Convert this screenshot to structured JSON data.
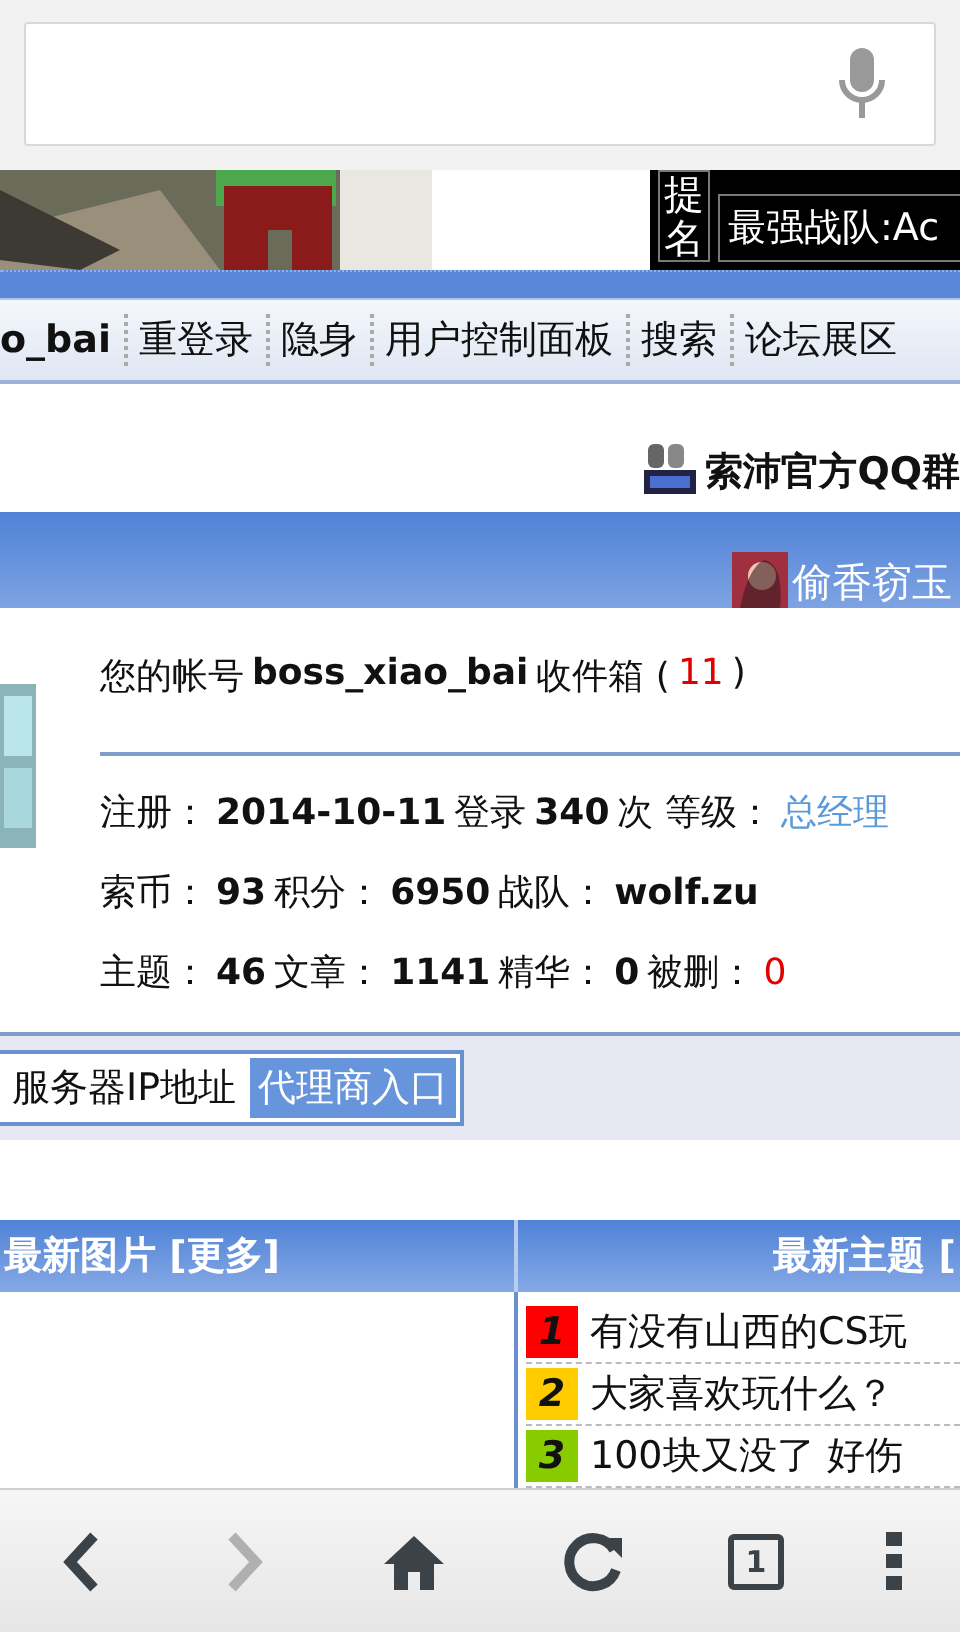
{
  "banner": {
    "vertical_label": "提名",
    "team_label": "最强战队:Ac"
  },
  "nav": {
    "items": [
      {
        "text": "o_bai",
        "bold": true
      },
      {
        "text": "重登录",
        "bold": false
      },
      {
        "text": "隐身",
        "bold": false
      },
      {
        "text": "用户控制面板",
        "bold": false
      },
      {
        "text": "搜索",
        "bold": false
      },
      {
        "text": "论坛展区",
        "bold": false
      }
    ]
  },
  "qq_group": "索沛官方QQ群",
  "user_bar": {
    "name": "偷香窃玉"
  },
  "info_lines": [
    [
      {
        "kind": "label",
        "text": "您的帐号"
      },
      {
        "kind": "value",
        "text": "boss_xiao_bai"
      },
      {
        "kind": "label",
        "text": "收件箱 ("
      },
      {
        "kind": "alert",
        "text": "11"
      },
      {
        "kind": "label",
        "text": ")"
      }
    ],
    [
      {
        "kind": "label",
        "text": "注册："
      },
      {
        "kind": "value",
        "text": "2014-10-11"
      },
      {
        "kind": "label",
        "text": "登录"
      },
      {
        "kind": "value",
        "text": "340"
      },
      {
        "kind": "label",
        "text": "次 等级："
      },
      {
        "kind": "link",
        "text": "总经理"
      }
    ],
    [
      {
        "kind": "label",
        "text": "索币："
      },
      {
        "kind": "value",
        "text": "93"
      },
      {
        "kind": "label",
        "text": "积分："
      },
      {
        "kind": "value",
        "text": "6950"
      },
      {
        "kind": "label",
        "text": "战队："
      },
      {
        "kind": "value",
        "text": "wolf.zu"
      }
    ],
    [
      {
        "kind": "label",
        "text": "主题："
      },
      {
        "kind": "value",
        "text": "46"
      },
      {
        "kind": "label",
        "text": "文章："
      },
      {
        "kind": "value",
        "text": "1141"
      },
      {
        "kind": "label",
        "text": "精华："
      },
      {
        "kind": "value",
        "text": "0"
      },
      {
        "kind": "label",
        "text": "被删："
      },
      {
        "kind": "alert",
        "text": "0"
      }
    ]
  ],
  "quick_links": [
    {
      "text": "服务器IP地址",
      "selected": false
    },
    {
      "text": "代理商入口",
      "selected": true
    }
  ],
  "panels": {
    "left_title": "最新图片 [更多]",
    "right_title": "最新主题 ["
  },
  "topics": [
    {
      "rank": "1",
      "color": "#ff0000",
      "title": "有没有山西的CS玩"
    },
    {
      "rank": "2",
      "color": "#ffcc00",
      "title": "大家喜欢玩什么？"
    },
    {
      "rank": "3",
      "color": "#88cc00",
      "title": "100块又没了 好伤"
    }
  ],
  "toolbar": {
    "back_disabled": false,
    "forward_disabled": true,
    "tab_count": "1"
  }
}
